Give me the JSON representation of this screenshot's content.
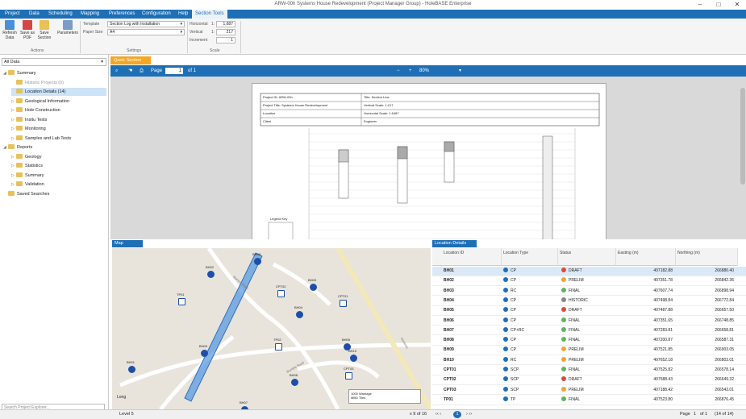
{
  "window": {
    "title": "ARW-00h Systems House Redevelopment (Project Manager Group) - HoleBASE Enterprise",
    "minimize": "–",
    "maximize": "□",
    "close": "✕"
  },
  "menu": [
    {
      "label": "Project"
    },
    {
      "label": "Data"
    },
    {
      "label": "Scheduling"
    },
    {
      "label": "Mapping"
    },
    {
      "label": "Preferences"
    },
    {
      "label": "Configuration"
    },
    {
      "label": "Help"
    },
    {
      "label": "Section Tools"
    }
  ],
  "ribbon": {
    "actions": [
      {
        "label": "Refresh Data",
        "icon": "refresh-icon",
        "color": "#4a90d9"
      },
      {
        "label": "Save as PDF",
        "icon": "pdf-icon",
        "color": "#d64545"
      },
      {
        "label": "Save Section",
        "icon": "save-section-icon",
        "color": "#e8c15a"
      },
      {
        "label": "Parameters",
        "icon": "parameters-icon",
        "color": "#7a9cc6"
      }
    ],
    "actions_group": "Actions",
    "template_label": "Template",
    "template_value": "Section Log with Installation",
    "paper_label": "Paper Size",
    "paper_value": "A4",
    "settings_group": "Settings",
    "horizontal_label": "Horizontal",
    "horizontal_prefix": "1:",
    "horizontal_value": "1,687",
    "vertical_label": "Vertical",
    "vertical_prefix": "1:",
    "vertical_value": "217",
    "increment_label": "Increment",
    "increment_value": "1",
    "scale_group": "Scale"
  },
  "explorer": {
    "filter": "All Data",
    "search_placeholder": "Search Project Explorer...",
    "items": [
      {
        "label": "Summary",
        "level": 0,
        "toggle": "◢"
      },
      {
        "label": "Historic Projects (0)",
        "level": 1,
        "toggle": "",
        "muted": true
      },
      {
        "label": "Location Details (14)",
        "level": 1,
        "toggle": "",
        "selected": true
      },
      {
        "label": "Geological Information",
        "level": 1,
        "toggle": "▷"
      },
      {
        "label": "Hole Construction",
        "level": 1,
        "toggle": "▷"
      },
      {
        "label": "Insitu Tests",
        "level": 1,
        "toggle": "▷"
      },
      {
        "label": "Monitoring",
        "level": 1,
        "toggle": "▷"
      },
      {
        "label": "Samples and Lab Tests",
        "level": 1,
        "toggle": "▷"
      },
      {
        "label": "Reports",
        "level": 0,
        "toggle": "◢"
      },
      {
        "label": "Geology",
        "level": 1,
        "toggle": "▷"
      },
      {
        "label": "Statistics",
        "level": 1,
        "toggle": "▷"
      },
      {
        "label": "Summary",
        "level": 1,
        "toggle": "▷"
      },
      {
        "label": "Validation",
        "level": 1,
        "toggle": "▷"
      },
      {
        "label": "Saved Searches",
        "level": 0,
        "toggle": ""
      }
    ]
  },
  "quick_section": {
    "tab": "Quick Section",
    "page_label": "Page",
    "page_value": "1",
    "page_of": "of 1",
    "zoom_minus": "−",
    "zoom_plus": "+",
    "zoom": "80%",
    "sheet": {
      "project_id": "Project ID: ARW-00h",
      "title": "Title: Section Line",
      "project_title": "Project Title: Systems House Redevelopment",
      "vertical_scale": "Vertical Scale: 1:217",
      "location": "Location",
      "horizontal_scale": "Horizontal Scale: 1:1687",
      "client": "Client",
      "engineer": "Engineer",
      "legend": "Legend Key"
    }
  },
  "map": {
    "tab": "Map",
    "scale_text": "1000 Wantage",
    "scale_text2": "MBD Tiles",
    "road_label1": "Barnes Road",
    "road_label2": "Bumble Road",
    "road_label3": "Sorrento",
    "north_label": "Long",
    "points": [
      {
        "label": "BH01",
        "type": "circle"
      },
      {
        "label": "BH02",
        "type": "circle"
      },
      {
        "label": "TP01",
        "type": "square"
      },
      {
        "label": "BH03",
        "type": "circle"
      },
      {
        "label": "CPT01",
        "type": "square"
      },
      {
        "label": "BH04",
        "type": "circle"
      },
      {
        "label": "CPT02",
        "type": "square"
      },
      {
        "label": "BH05",
        "type": "circle"
      },
      {
        "label": "TP02",
        "type": "square"
      },
      {
        "label": "BH06",
        "type": "circle"
      },
      {
        "label": "CPT03",
        "type": "square"
      },
      {
        "label": "BH07",
        "type": "circle"
      },
      {
        "label": "BH08",
        "type": "circle"
      },
      {
        "label": "BH09",
        "type": "circle"
      },
      {
        "label": "BH10",
        "type": "circle"
      }
    ]
  },
  "location_details": {
    "tab": "Location Details",
    "columns": [
      "Location ID",
      "Location Type",
      "Status",
      "Easting (m)",
      "Northing (m)"
    ],
    "rows": [
      {
        "id": "BH01",
        "type": "CP",
        "status": "DRAFT",
        "status_color": "#e0483a",
        "easting": "407182.88",
        "northing": "266880.40"
      },
      {
        "id": "BH02",
        "type": "CP",
        "status": "PRELIM",
        "status_color": "#f0a531",
        "easting": "407351.78",
        "northing": "266842.36"
      },
      {
        "id": "BH03",
        "type": "RC",
        "status": "FINAL",
        "status_color": "#5cb85c",
        "easting": "407607.74",
        "northing": "266898.94"
      },
      {
        "id": "BH04",
        "type": "CP",
        "status": "HISTORIC",
        "status_color": "#888888",
        "easting": "407498.84",
        "northing": "266772.84"
      },
      {
        "id": "BH05",
        "type": "CP",
        "status": "DRAFT",
        "status_color": "#e0483a",
        "easting": "407487.88",
        "northing": "266657.50"
      },
      {
        "id": "BH06",
        "type": "CP",
        "status": "FINAL",
        "status_color": "#5cb85c",
        "easting": "407351.65",
        "northing": "266748.85"
      },
      {
        "id": "BH07",
        "type": "CP+RC",
        "status": "FINAL",
        "status_color": "#5cb85c",
        "easting": "407283.81",
        "northing": "266658.81"
      },
      {
        "id": "BH08",
        "type": "CP",
        "status": "FINAL",
        "status_color": "#5cb85c",
        "easting": "407200.87",
        "northing": "266587.31"
      },
      {
        "id": "BH09",
        "type": "CP",
        "status": "PRELIM",
        "status_color": "#f0a531",
        "easting": "407521.85",
        "northing": "266903.05"
      },
      {
        "id": "BH10",
        "type": "RC",
        "status": "PRELIM",
        "status_color": "#f0a531",
        "easting": "407652.18",
        "northing": "266803.01"
      },
      {
        "id": "CPT01",
        "type": "SCP",
        "status": "FINAL",
        "status_color": "#5cb85c",
        "easting": "407525.82",
        "northing": "266578.14"
      },
      {
        "id": "CPT02",
        "type": "SCP",
        "status": "DRAFT",
        "status_color": "#e0483a",
        "easting": "407588.43",
        "northing": "266649.32"
      },
      {
        "id": "CPT03",
        "type": "SCP",
        "status": "PRELIM",
        "status_color": "#f0a531",
        "easting": "407188.42",
        "northing": "266543.01"
      },
      {
        "id": "TP01",
        "type": "TP",
        "status": "FINAL",
        "status_color": "#5cb85c",
        "easting": "407523.80",
        "northing": "266876.45"
      }
    ],
    "page_label": "Page",
    "page_value": "1",
    "page_of": "of 1",
    "record_count": "(14 of 14)"
  },
  "statusbar": {
    "level": "Level 5",
    "pager": "‹‹  ‹",
    "page_current": "1",
    "pager_next": "›  ››",
    "record_text": "x 9 of 16"
  },
  "accent": "#1e6fb6",
  "tab_accent": "#f6a623"
}
